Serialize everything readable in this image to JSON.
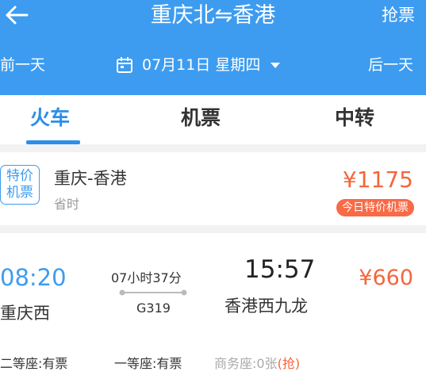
{
  "header": {
    "title": "重庆北⇋香港",
    "grab_label": "抢票",
    "prev_day": "前一天",
    "next_day": "后一天",
    "date": "07月11日 星期四"
  },
  "tabs": [
    "火车",
    "机票",
    "中转"
  ],
  "flight": {
    "badge_line1": "特价",
    "badge_line2": "机票",
    "route": "重庆-香港",
    "note": "省时",
    "price": "¥1175",
    "tag": "今日特价机票"
  },
  "train": {
    "dep_time": "08:20",
    "dep_station": "重庆西",
    "duration": "07小时37分",
    "train_no": "G319",
    "arr_time": "15:57",
    "arr_station": "香港西九龙",
    "price": "¥660",
    "seats": {
      "second": "二等座:有票",
      "first": "一等座:有票",
      "business": "商务座:0张",
      "business_action": "(抢)"
    }
  },
  "colors": {
    "brand_blue": "#3d9cf0",
    "price_orange": "#f4663b"
  },
  "icons": {
    "back": "arrow-left-icon",
    "calendar": "calendar-icon",
    "caret": "caret-down-icon"
  }
}
